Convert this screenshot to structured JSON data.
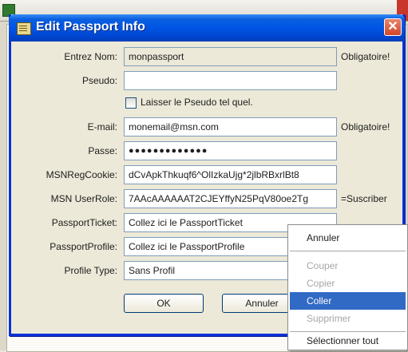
{
  "dialog": {
    "title": "Edit Passport Info",
    "close_glyph": "✕"
  },
  "form": {
    "nom_label": "Entrez Nom:",
    "nom_value": "monpassport",
    "nom_note": "Obligatoire!",
    "pseudo_label": "Pseudo:",
    "pseudo_value": "",
    "keep_pseudo_label": "Laisser le Pseudo tel quel.",
    "email_label": "E-mail:",
    "email_value": "monemail@msn.com",
    "email_note": "Obligatoire!",
    "passe_label": "Passe:",
    "passe_value": "●●●●●●●●●●●●●",
    "cookie_label": "MSNRegCookie:",
    "cookie_value": "dCvApkThkuqf6^OlIzkaUjg*2jlbRBxrlBt8",
    "role_label": "MSN UserRole:",
    "role_value": "7AAcAAAAAAT2CJEYffyN25PqV80oe2Tg",
    "role_note": "=Suscriber",
    "ticket_label": "PassportTicket:",
    "ticket_value": "Collez ici le PassportTicket",
    "profile_label": "PassportProfile:",
    "profile_value": "Collez ici le PassportProfile",
    "type_label": "Profile Type:",
    "type_value": "Sans Profil"
  },
  "buttons": {
    "ok": "OK",
    "cancel": "Annuler"
  },
  "context_menu": {
    "items": [
      "Annuler",
      "Couper",
      "Copier",
      "Coller",
      "Supprimer",
      "Sélectionner tout"
    ],
    "active": "Coller"
  },
  "colors": {
    "titlebar": "#0055e5",
    "highlight": "#316ac5",
    "close": "#d2462a"
  }
}
